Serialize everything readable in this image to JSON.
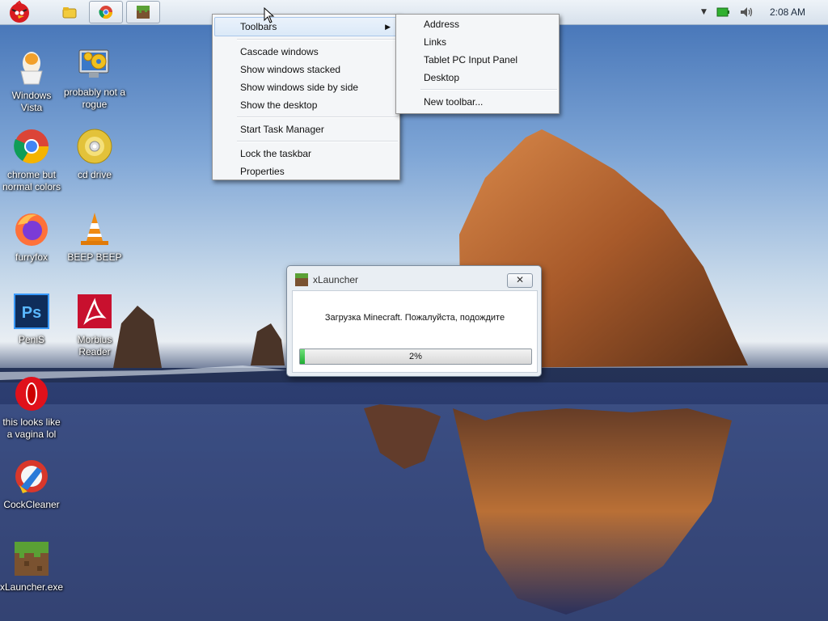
{
  "taskbar": {
    "clock": "2:08 AM"
  },
  "desktop_icons": [
    {
      "label": "Windows Vista",
      "icon": "egg-icon"
    },
    {
      "label": "probably not a rogue",
      "icon": "gears-monitor-icon"
    },
    {
      "label": "chrome but normal colors",
      "icon": "chrome-icon"
    },
    {
      "label": "cd drive",
      "icon": "cd-drive-icon"
    },
    {
      "label": "furryfox",
      "icon": "firefox-icon"
    },
    {
      "label": "BEEP BEEP",
      "icon": "traffic-cone-icon"
    },
    {
      "label": "PeniS",
      "icon": "photoshop-icon"
    },
    {
      "label": "Morbius Reader",
      "icon": "pdf-reader-icon"
    },
    {
      "label": "this looks like a vagina lol",
      "icon": "opera-icon"
    },
    {
      "label": "CockCleaner",
      "icon": "ccleaner-icon"
    },
    {
      "label": "xLauncher.exe",
      "icon": "minecraft-block-icon"
    }
  ],
  "context_menu": {
    "items": [
      {
        "label": "Toolbars",
        "submenu": true
      },
      {
        "label": "Cascade windows"
      },
      {
        "label": "Show windows stacked"
      },
      {
        "label": "Show windows side by side"
      },
      {
        "label": "Show the desktop"
      },
      {
        "label": "Start Task Manager"
      },
      {
        "label": "Lock the taskbar"
      },
      {
        "label": "Properties"
      }
    ]
  },
  "toolbars_submenu": {
    "items": [
      {
        "label": "Address"
      },
      {
        "label": "Links"
      },
      {
        "label": "Tablet PC Input Panel"
      },
      {
        "label": "Desktop"
      },
      {
        "label": "New toolbar..."
      }
    ]
  },
  "dialog": {
    "title": "xLauncher",
    "close_label": "✕",
    "message": "Загрузка Minecraft. Пожалуйста, подождите",
    "progress_text": "2%",
    "progress_value": 0.02
  },
  "colors": {
    "progress_fill": "#1fae32",
    "menu_highlight": "#dbe9f8"
  }
}
